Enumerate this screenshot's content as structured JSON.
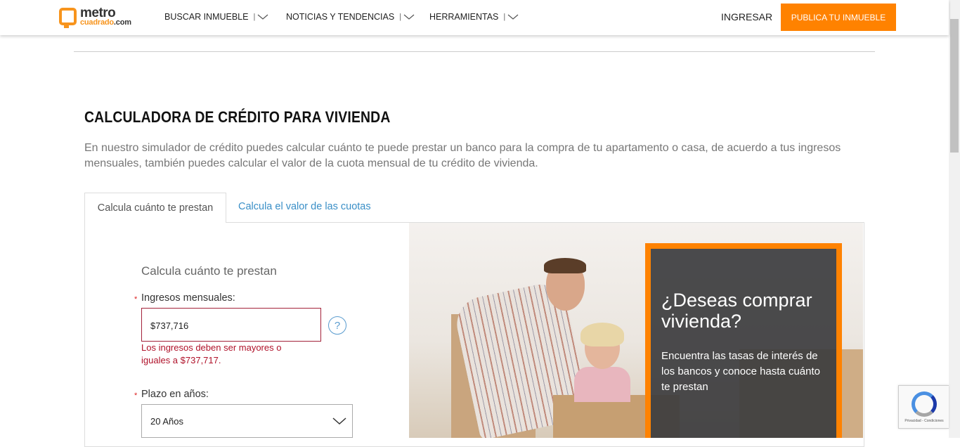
{
  "header": {
    "logo_top": "metro",
    "logo_bottom_a": "cuadrado",
    "logo_bottom_b": ".com",
    "nav": [
      {
        "label": "BUSCAR INMUEBLE",
        "sep": "|"
      },
      {
        "label": "NOTICIAS Y TENDENCIAS",
        "sep": "|"
      },
      {
        "label": "HERRAMIENTAS",
        "sep": "|"
      }
    ],
    "login": "INGRESAR",
    "publish": "PUBLICA TU INMUEBLE"
  },
  "page": {
    "title": "CALCULADORA DE CRÉDITO PARA VIVIENDA",
    "description": "En nuestro simulador de crédito puedes calcular cuánto te puede prestar un banco para la compra de tu apartamento o casa, de acuerdo a tus ingresos mensuales, también puedes calcular el valor de la cuota mensual de tu crédito de vivienda."
  },
  "tabs": [
    {
      "label": "Calcula cuánto te prestan",
      "active": true
    },
    {
      "label": "Calcula el valor de las cuotas",
      "active": false
    }
  ],
  "form": {
    "title": "Calcula cuánto te prestan",
    "required_mark": "*",
    "income_label": "Ingresos mensuales:",
    "income_value": "$737,716",
    "help": "?",
    "income_error": "Los ingresos deben ser mayores o iguales a $737,717.",
    "term_label": "Plazo en años:",
    "term_value": "20 Años"
  },
  "promo": {
    "title": "¿Deseas comprar vivienda?",
    "text": "Encuentra las tasas de interés de los bancos y conoce hasta cuánto te prestan"
  },
  "recaptcha": {
    "text": "Privacidad - Condiciones"
  },
  "colors": {
    "accent": "#ff8200",
    "link": "#3a8fc7",
    "error": "#b0122a"
  }
}
